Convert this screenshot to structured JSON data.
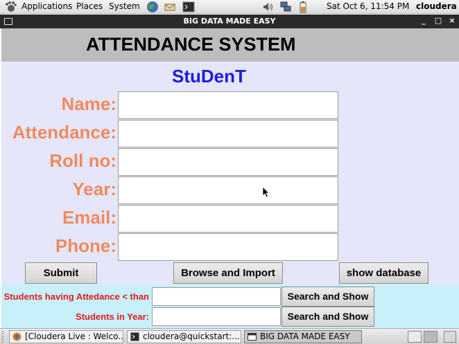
{
  "top_panel": {
    "menus": [
      "Applications",
      "Places",
      "System"
    ],
    "clock": "Sat Oct  6, 11:54 PM",
    "user": "cloudera"
  },
  "window": {
    "title": "BIG DATA MADE EASY",
    "controls": [
      "minimize-icon",
      "maximize-icon",
      "close-icon"
    ]
  },
  "app": {
    "heading": "ATTENDANCE SYSTEM",
    "subtitle": "StuDenT",
    "fields": [
      {
        "label": "Name:",
        "value": ""
      },
      {
        "label": "Attendance:",
        "value": ""
      },
      {
        "label": "Roll no:",
        "value": ""
      },
      {
        "label": "Year:",
        "value": ""
      },
      {
        "label": "Email:",
        "value": ""
      },
      {
        "label": "Phone:",
        "value": ""
      }
    ],
    "buttons": {
      "submit": "Submit",
      "browse": "Browse and Import",
      "show_db": "show database"
    },
    "search": {
      "attendance_label": "Students having Attedance < than",
      "year_label": "Students in Year:",
      "search_button": "Search and Show"
    }
  },
  "taskbar": {
    "tasks": [
      "[Cloudera Live : Welco...",
      "cloudera@quickstart:...",
      "BIG DATA MADE EASY"
    ]
  },
  "colors": {
    "label_orange": "#f08a5d",
    "subtitle_blue": "#1a1ae6",
    "search_red": "#e01a1a",
    "form_bg": "#e6e6fb",
    "search_bg": "#c7f0fa",
    "header_bg": "#bdbdbd"
  }
}
